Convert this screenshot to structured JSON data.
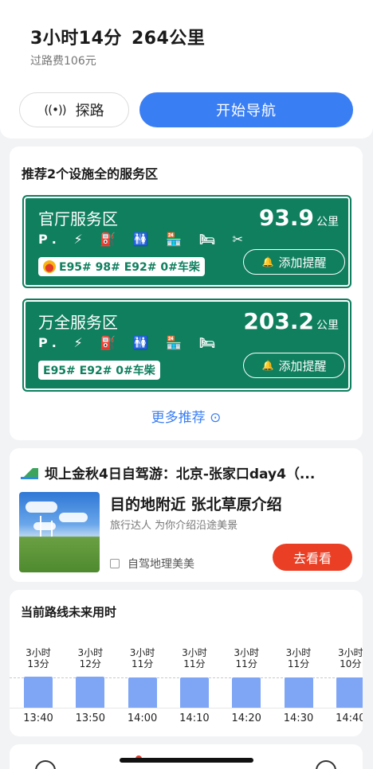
{
  "route": {
    "duration": "3小时14分",
    "distance": "264公里",
    "toll": "过路费106元"
  },
  "actions": {
    "explore_icon": "((•))",
    "explore_label": "探路",
    "navigate_label": "开始导航"
  },
  "service_areas": {
    "title": "推荐2个设施全的服务区",
    "items": [
      {
        "name": "官厅服务区",
        "distance": "93.9",
        "unit": "公里",
        "facilities": "P. ⚡ ⛽ 🚻 🏪 🛏 ✂",
        "fuel": "E95# 98# E92# 0#车柴",
        "remind_label": "添加提醒"
      },
      {
        "name": "万全服务区",
        "distance": "203.2",
        "unit": "公里",
        "facilities": "P. ⚡ ⛽ 🚻 🏪 🛏",
        "fuel": "E95# E92# 0#车柴",
        "remind_label": "添加提醒"
      }
    ],
    "more_label": "更多推荐 ⊙"
  },
  "trip": {
    "title": "坝上金秋4日自驾游：北京-张家口day4（...",
    "dest_title": "目的地附近 张北草原介绍",
    "dest_sub": "旅行达人 为你介绍沿途美景",
    "author": "自驾地理美美",
    "see_label": "去看看"
  },
  "future_time": {
    "title": "当前路线未来用时"
  },
  "chart_data": {
    "type": "bar",
    "categories": [
      "13:40",
      "13:50",
      "14:00",
      "14:10",
      "14:20",
      "14:30",
      "14:40"
    ],
    "values": [
      193,
      192,
      191,
      191,
      191,
      191,
      190
    ],
    "value_labels": [
      [
        "3小时",
        "13分"
      ],
      [
        "3小时",
        "12分"
      ],
      [
        "3小时",
        "11分"
      ],
      [
        "3小时",
        "11分"
      ],
      [
        "3小时",
        "11分"
      ],
      [
        "3小时",
        "11分"
      ],
      [
        "3小时",
        "10分"
      ]
    ],
    "xlabel": "",
    "ylabel": "",
    "bar_color": "#7fa6f5"
  },
  "colors": {
    "accent_blue": "#3a7ef3",
    "service_green": "#0f7f5e",
    "cta_red": "#ea3f25"
  }
}
